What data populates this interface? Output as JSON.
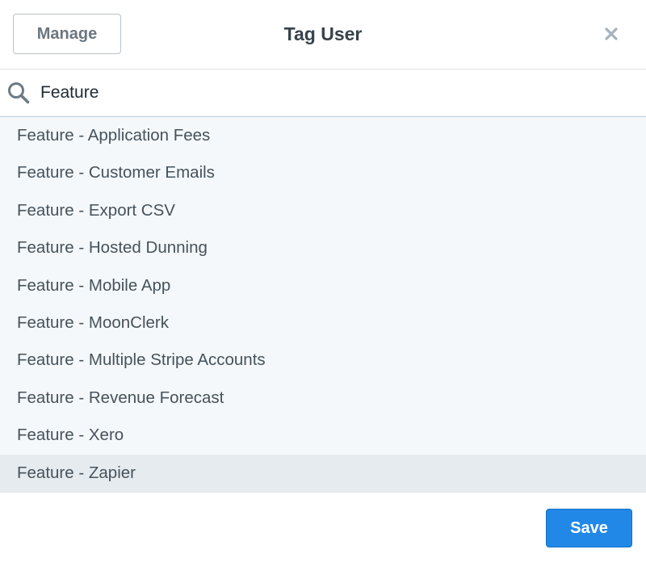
{
  "header": {
    "manage_label": "Manage",
    "title": "Tag User",
    "close_icon": "close-icon"
  },
  "search": {
    "icon": "search-icon",
    "value": "Feature"
  },
  "results": {
    "items": [
      {
        "label": "Feature - Application Fees",
        "highlighted": false
      },
      {
        "label": "Feature - Customer Emails",
        "highlighted": false
      },
      {
        "label": "Feature - Export CSV",
        "highlighted": false
      },
      {
        "label": "Feature - Hosted Dunning",
        "highlighted": false
      },
      {
        "label": "Feature - Mobile App",
        "highlighted": false
      },
      {
        "label": "Feature - MoonClerk",
        "highlighted": false
      },
      {
        "label": "Feature - Multiple Stripe Accounts",
        "highlighted": false
      },
      {
        "label": "Feature - Revenue Forecast",
        "highlighted": false
      },
      {
        "label": "Feature - Xero",
        "highlighted": false
      },
      {
        "label": "Feature - Zapier",
        "highlighted": true
      }
    ]
  },
  "footer": {
    "save_label": "Save"
  },
  "colors": {
    "primary": "#2188e8",
    "list_background": "#f4f8fb",
    "highlight": "#e6ebef"
  }
}
